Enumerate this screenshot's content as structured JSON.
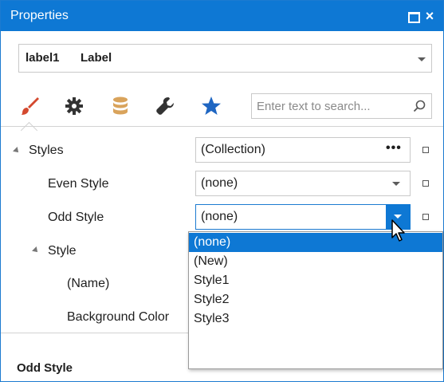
{
  "window": {
    "title": "Properties",
    "maximize_glyph": "",
    "close_glyph": "×"
  },
  "object_selector": {
    "name": "label1",
    "type": "Label"
  },
  "toolbar": {
    "tabs": [
      {
        "icon": "brush-icon",
        "active": true
      },
      {
        "icon": "gear-icon",
        "active": false
      },
      {
        "icon": "database-icon",
        "active": false
      },
      {
        "icon": "wrench-icon",
        "active": false
      },
      {
        "icon": "star-icon",
        "active": false
      }
    ],
    "search_placeholder": "Enter text to search..."
  },
  "properties": [
    {
      "label": "Styles",
      "value": "(Collection)",
      "expandable": true
    },
    {
      "label": "Even Style",
      "value": "(none)"
    },
    {
      "label": "Odd Style",
      "value": "(none)"
    },
    {
      "label": "Style",
      "value": "",
      "expandable": true
    },
    {
      "label": "(Name)",
      "value": ""
    },
    {
      "label": "Background Color",
      "value": ""
    }
  ],
  "dropdown": {
    "selected": "(none)",
    "options": [
      "(none)",
      "(New)",
      "Style1",
      "Style2",
      "Style3"
    ]
  },
  "description": {
    "title": "Odd Style"
  },
  "colors": {
    "accent": "#0e78d4",
    "icon_brush": "#d4492f",
    "icon_gear": "#333333",
    "icon_database": "#d9a35b",
    "icon_star": "#1f66c2"
  }
}
